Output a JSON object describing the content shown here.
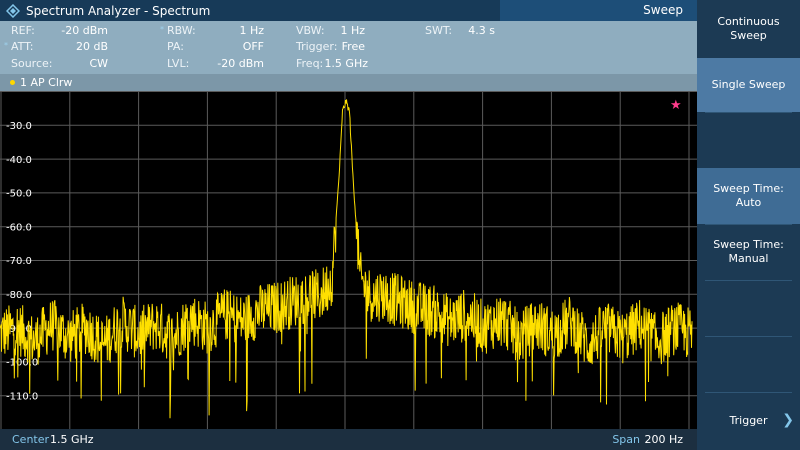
{
  "title_bar": {
    "app_title": "Spectrum Analyzer - Spectrum",
    "menu_title": "Sweep"
  },
  "settings": {
    "ref_label": "REF:",
    "ref_value": "-20 dBm",
    "att_label": "ATT:",
    "att_value": "20 dB",
    "source_label": "Source:",
    "source_value": "CW",
    "rbw_label": "RBW:",
    "rbw_value": "1 Hz",
    "pa_label": "PA:",
    "pa_value": "OFF",
    "lvl_label": "LVL:",
    "lvl_value": "-20 dBm",
    "vbw_label": "VBW:",
    "vbw_value": "1 Hz",
    "trigger_label": "Trigger:",
    "trigger_value": "Free",
    "freq_label": "Freq:",
    "freq_value": "1.5 GHz",
    "swt_label": "SWT:",
    "swt_value": "4.3 s"
  },
  "trace": {
    "label": "1 AP  Clrw"
  },
  "bottom_bar": {
    "center_label": "Center",
    "center_value": "1.5 GHz",
    "span_label": "Span",
    "span_value": "200 Hz"
  },
  "softkeys": {
    "continuous_sweep": [
      "Continuous",
      "Sweep"
    ],
    "single_sweep": "Single Sweep",
    "sweep_time_auto": [
      "Sweep Time:",
      "Auto"
    ],
    "sweep_time_manual": [
      "Sweep Time:",
      "Manual"
    ],
    "trigger": "Trigger"
  },
  "colors": {
    "trace": "#ffe000",
    "grid": "#5b5b5b",
    "marker_star": "#ff3c8c",
    "accent": "#83c6ea"
  },
  "chart_data": {
    "type": "line",
    "xlabel": "",
    "ylabel": "",
    "ytick_labels": [
      "-30.0",
      "-40.0",
      "-50.0",
      "-60.0",
      "-70.0",
      "-80.0",
      "-90.0",
      "-100.0",
      "-110.0"
    ],
    "ytick_values": [
      -30,
      -40,
      -50,
      -60,
      -70,
      -80,
      -90,
      -100,
      -110
    ],
    "ylim": [
      -120,
      -20
    ],
    "xlim": [
      -100,
      100
    ],
    "x_unit": "Hz offset from center",
    "grid": true,
    "series": [
      {
        "x": [
          -100,
          -95,
          -90,
          -85,
          -80,
          -75,
          -70,
          -65,
          -60,
          -55,
          -50,
          -45,
          -40,
          -35,
          -30,
          -25,
          -20,
          -15,
          -10,
          -8,
          -6,
          -4,
          -2,
          -1,
          0,
          1,
          2,
          4,
          6,
          8,
          10,
          15,
          20,
          25,
          30,
          35,
          40,
          45,
          50,
          55,
          60,
          65,
          70,
          75,
          80,
          85,
          90,
          95,
          100
        ],
        "values": [
          -92,
          -90,
          -94,
          -89,
          -93,
          -90,
          -95,
          -88,
          -92,
          -89,
          -93,
          -87,
          -90,
          -86,
          -88,
          -85,
          -84,
          -82,
          -80,
          -81,
          -79,
          -75,
          -45,
          -26,
          -23,
          -26,
          -45,
          -75,
          -79,
          -81,
          -80,
          -82,
          -84,
          -85,
          -88,
          -86,
          -90,
          -87,
          -93,
          -89,
          -92,
          -88,
          -95,
          -90,
          -93,
          -89,
          -94,
          -90,
          -92
        ]
      }
    ]
  }
}
